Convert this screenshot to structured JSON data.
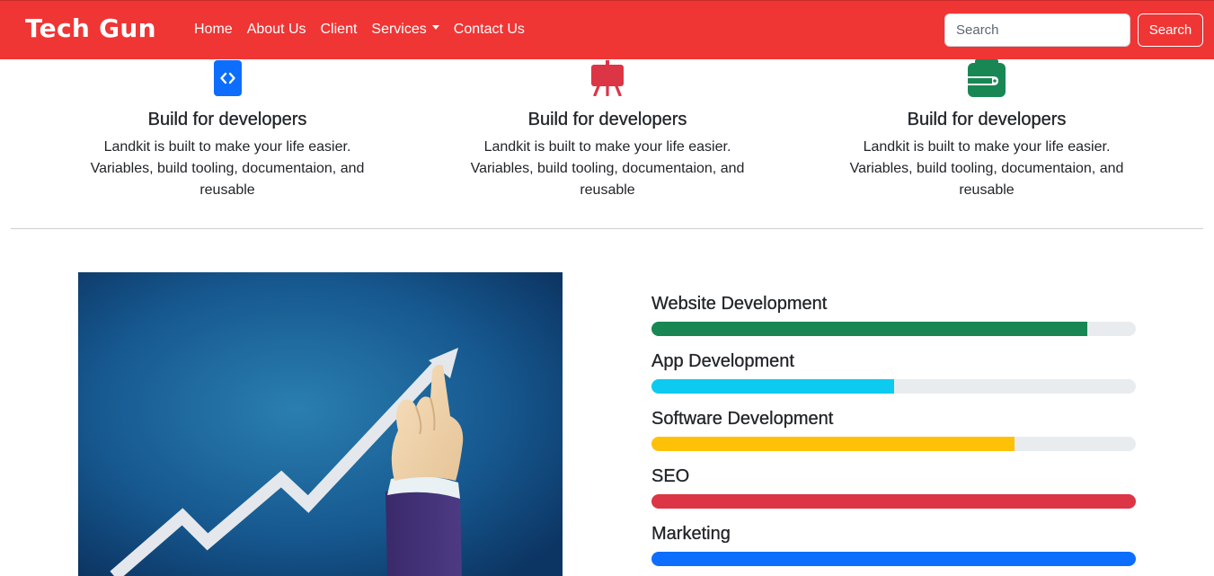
{
  "navbar": {
    "brand": "Tech Gun",
    "links": [
      "Home",
      "About Us",
      "Client",
      "Services",
      "Contact Us"
    ],
    "search_placeholder": "Search",
    "search_button": "Search",
    "colors": {
      "background": "#f03535"
    }
  },
  "features": [
    {
      "icon": "code-icon",
      "icon_color": "#0d6efd",
      "title": "Build for developers",
      "lines": [
        "Landkit is built to make your life easier.",
        "Variables, build tooling, documentaion, and",
        "reusable"
      ]
    },
    {
      "icon": "easel-icon",
      "icon_color": "#dc3545",
      "title": "Build for developers",
      "lines": [
        "Landkit is built to make your life easier.",
        "Variables, build tooling, documentaion, and",
        "reusable"
      ]
    },
    {
      "icon": "wallet-icon",
      "icon_color": "#198754",
      "title": "Build for developers",
      "lines": [
        "Landkit is built to make your life easier.",
        "Variables, build tooling, documentaion, and",
        "reusable"
      ]
    }
  ],
  "hero_image": {
    "description_icon": "growth-chart-hand-image"
  },
  "skills": [
    {
      "label": "Website Development",
      "percent": 90,
      "color": "#198754"
    },
    {
      "label": "App Development",
      "percent": 50,
      "color": "#0dcaf0"
    },
    {
      "label": "Software Development",
      "percent": 75,
      "color": "#ffc107"
    },
    {
      "label": "SEO",
      "percent": 100,
      "color": "#dc3545"
    },
    {
      "label": "Marketing",
      "percent": 100,
      "color": "#0d6efd"
    }
  ]
}
